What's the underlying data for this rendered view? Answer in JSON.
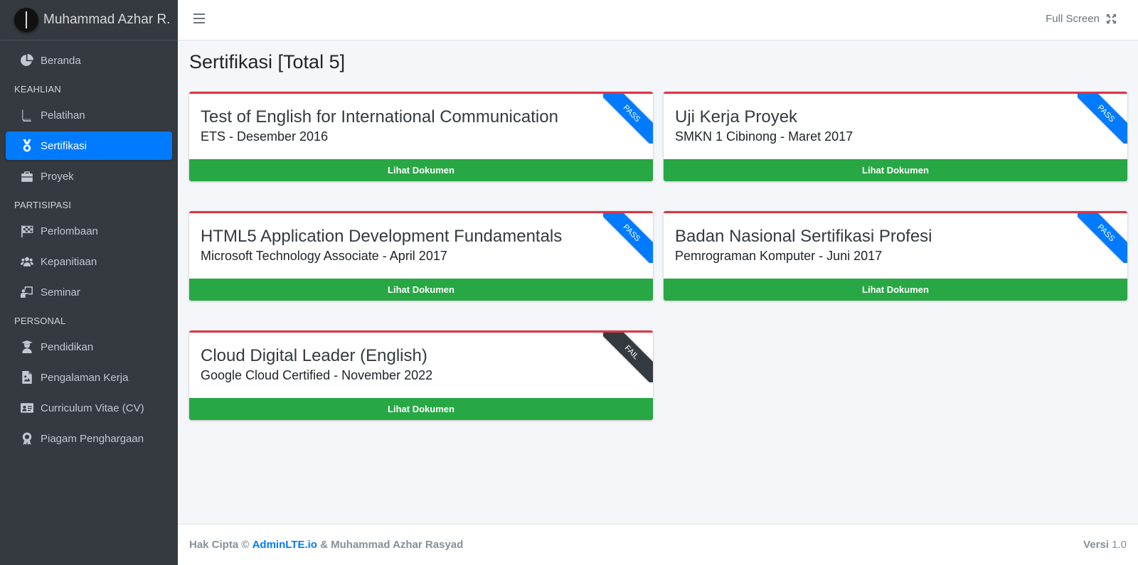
{
  "brand": {
    "name": "Muhammad Azhar R."
  },
  "nav": {
    "home": "Beranda",
    "header_keahlian": "KEAHLIAN",
    "pelatihan": "Pelatihan",
    "sertifikasi": "Sertifikasi",
    "proyek": "Proyek",
    "header_partisipasi": "PARTISIPASI",
    "perlombaan": "Perlombaan",
    "kepanitiaan": "Kepanitiaan",
    "seminar": "Seminar",
    "header_personal": "PERSONAL",
    "pendidikan": "Pendidikan",
    "pengalaman": "Pengalaman Kerja",
    "cv": "Curriculum Vitae (CV)",
    "piagam": "Piagam Penghargaan"
  },
  "topbar": {
    "fullscreen_label": "Full Screen"
  },
  "page": {
    "title": "Sertifikasi [Total 5]"
  },
  "cards": [
    {
      "title": "Test of English for International Communication",
      "subtitle": "ETS - Desember 2016",
      "status": "PASS",
      "button": "Lihat Dokumen"
    },
    {
      "title": "Uji Kerja Proyek",
      "subtitle": "SMKN 1 Cibinong - Maret 2017",
      "status": "PASS",
      "button": "Lihat Dokumen"
    },
    {
      "title": "HTML5 Application Development Fundamentals",
      "subtitle": "Microsoft Technology Associate - April 2017",
      "status": "PASS",
      "button": "Lihat Dokumen"
    },
    {
      "title": "Badan Nasional Sertifikasi Profesi",
      "subtitle": "Pemrograman Komputer - Juni 2017",
      "status": "PASS",
      "button": "Lihat Dokumen"
    },
    {
      "title": "Cloud Digital Leader (English)",
      "subtitle": "Google Cloud Certified - November 2022",
      "status": "FAIL",
      "button": "Lihat Dokumen"
    }
  ],
  "footer": {
    "copyright_prefix": "Hak Cipta ©",
    "link": "AdminLTE.io",
    "copyright_suffix": "& Muhammad Azhar Rasyad",
    "version_label": "Versi",
    "version_value": "1.0"
  },
  "colors": {
    "accent": "#007bff",
    "success": "#28a745",
    "danger": "#dc3545",
    "sidebar": "#343a40"
  }
}
